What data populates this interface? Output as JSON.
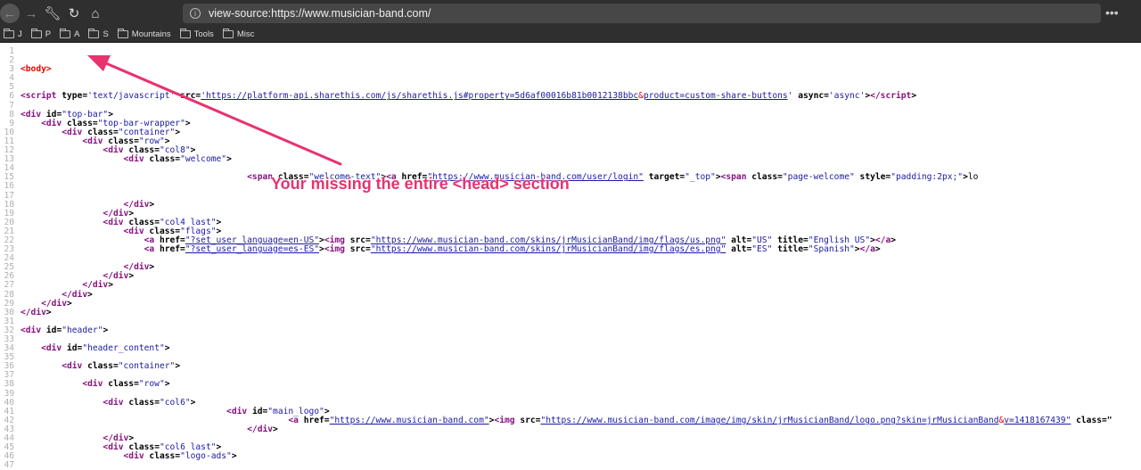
{
  "browser": {
    "url": "view-source:https://www.musician-band.com/",
    "nav_icons": [
      "back-icon",
      "forward-icon",
      "wrench-icon",
      "reload-icon",
      "home-icon"
    ],
    "bookmarks": [
      "J",
      "P",
      "A",
      "S",
      "Mountains",
      "Tools",
      "Misc"
    ],
    "more": "•••"
  },
  "annotation": {
    "text": "Your missing the entire <head> section",
    "color": "#e8336e"
  },
  "lines": [
    [],
    [],
    [
      [
        "body",
        "<body>"
      ]
    ],
    [],
    [],
    [
      [
        "tag",
        "<script "
      ],
      [
        "attr",
        "type="
      ],
      [
        "val",
        "'text/javascript'"
      ],
      [
        "attr",
        " src="
      ],
      [
        "link",
        "'https://platform-api.sharethis.com/js/sharethis.js#property=5d6af00016b81b0012138bbc"
      ],
      [
        "amp",
        "&"
      ],
      [
        "link",
        "product=custom-share-buttons"
      ],
      [
        "val",
        "'"
      ],
      [
        "attr",
        " async="
      ],
      [
        "val",
        "'async'"
      ],
      [
        "attr",
        ">"
      ],
      [
        "tag",
        "</script"
      ],
      [
        "attr",
        ">"
      ]
    ],
    [],
    [
      [
        "tag",
        "<div "
      ],
      [
        "attr",
        "id="
      ],
      [
        "val",
        "\"top-bar\""
      ],
      [
        "attr",
        ">"
      ]
    ],
    [
      [
        "txt",
        "    "
      ],
      [
        "tag",
        "<div "
      ],
      [
        "attr",
        "class="
      ],
      [
        "val",
        "\"top-bar-wrapper\""
      ],
      [
        "attr",
        ">"
      ]
    ],
    [
      [
        "txt",
        "        "
      ],
      [
        "tag",
        "<div "
      ],
      [
        "attr",
        "class="
      ],
      [
        "val",
        "\"container\""
      ],
      [
        "attr",
        ">"
      ]
    ],
    [
      [
        "txt",
        "            "
      ],
      [
        "tag",
        "<div "
      ],
      [
        "attr",
        "class="
      ],
      [
        "val",
        "\"row\""
      ],
      [
        "attr",
        ">"
      ]
    ],
    [
      [
        "txt",
        "                "
      ],
      [
        "tag",
        "<div "
      ],
      [
        "attr",
        "class="
      ],
      [
        "val",
        "\"col8\""
      ],
      [
        "attr",
        ">"
      ]
    ],
    [
      [
        "txt",
        "                    "
      ],
      [
        "tag",
        "<div "
      ],
      [
        "attr",
        "class="
      ],
      [
        "val",
        "\"welcome\""
      ],
      [
        "attr",
        ">"
      ]
    ],
    [],
    [
      [
        "txt",
        "                                            "
      ],
      [
        "tag",
        "<span "
      ],
      [
        "attr",
        "class="
      ],
      [
        "val",
        "\"welcome-text\""
      ],
      [
        "attr",
        ">"
      ],
      [
        "tag",
        "<a "
      ],
      [
        "attr",
        "href="
      ],
      [
        "link",
        "\"https://www.musician-band.com/user/login\""
      ],
      [
        "attr",
        " target="
      ],
      [
        "val",
        "\"_top\""
      ],
      [
        "attr",
        ">"
      ],
      [
        "tag",
        "<span "
      ],
      [
        "attr",
        "class="
      ],
      [
        "val",
        "\"page-welcome\""
      ],
      [
        "attr",
        " style="
      ],
      [
        "val",
        "\"padding:2px;\""
      ],
      [
        "attr",
        ">"
      ],
      [
        "txt",
        "lo"
      ]
    ],
    [],
    [],
    [
      [
        "txt",
        "                    "
      ],
      [
        "tag",
        "</div"
      ],
      [
        "attr",
        ">"
      ]
    ],
    [
      [
        "txt",
        "                "
      ],
      [
        "tag",
        "</div"
      ],
      [
        "attr",
        ">"
      ]
    ],
    [
      [
        "txt",
        "                "
      ],
      [
        "tag",
        "<div "
      ],
      [
        "attr",
        "class="
      ],
      [
        "val",
        "\"col4 last\""
      ],
      [
        "attr",
        ">"
      ]
    ],
    [
      [
        "txt",
        "                    "
      ],
      [
        "tag",
        "<div "
      ],
      [
        "attr",
        "class="
      ],
      [
        "val",
        "\"flags\""
      ],
      [
        "attr",
        ">"
      ]
    ],
    [
      [
        "txt",
        "                        "
      ],
      [
        "tag",
        "<a "
      ],
      [
        "attr",
        "href="
      ],
      [
        "link",
        "\"?set_user_language=en-US\""
      ],
      [
        "attr",
        ">"
      ],
      [
        "tag",
        "<img "
      ],
      [
        "attr",
        "src="
      ],
      [
        "link",
        "\"https://www.musician-band.com/skins/jrMusicianBand/img/flags/us.png\""
      ],
      [
        "attr",
        " alt="
      ],
      [
        "val",
        "\"US\""
      ],
      [
        "attr",
        " title="
      ],
      [
        "val",
        "\"English US\""
      ],
      [
        "attr",
        ">"
      ],
      [
        "tag",
        "</a"
      ],
      [
        "attr",
        ">"
      ]
    ],
    [
      [
        "txt",
        "                        "
      ],
      [
        "tag",
        "<a "
      ],
      [
        "attr",
        "href="
      ],
      [
        "link",
        "\"?set_user_language=es-ES\""
      ],
      [
        "attr",
        ">"
      ],
      [
        "tag",
        "<img "
      ],
      [
        "attr",
        "src="
      ],
      [
        "link",
        "\"https://www.musician-band.com/skins/jrMusicianBand/img/flags/es.png\""
      ],
      [
        "attr",
        " alt="
      ],
      [
        "val",
        "\"ES\""
      ],
      [
        "attr",
        " title="
      ],
      [
        "val",
        "\"Spanish\""
      ],
      [
        "attr",
        ">"
      ],
      [
        "tag",
        "</a"
      ],
      [
        "attr",
        ">"
      ]
    ],
    [],
    [
      [
        "txt",
        "                    "
      ],
      [
        "tag",
        "</div"
      ],
      [
        "attr",
        ">"
      ]
    ],
    [
      [
        "txt",
        "                "
      ],
      [
        "tag",
        "</div"
      ],
      [
        "attr",
        ">"
      ]
    ],
    [
      [
        "txt",
        "            "
      ],
      [
        "tag",
        "</div"
      ],
      [
        "attr",
        ">"
      ]
    ],
    [
      [
        "txt",
        "        "
      ],
      [
        "tag",
        "</div"
      ],
      [
        "attr",
        ">"
      ]
    ],
    [
      [
        "txt",
        "    "
      ],
      [
        "tag",
        "</div"
      ],
      [
        "attr",
        ">"
      ]
    ],
    [
      [
        "tag",
        "</div"
      ],
      [
        "attr",
        ">"
      ]
    ],
    [],
    [
      [
        "tag",
        "<div "
      ],
      [
        "attr",
        "id="
      ],
      [
        "val",
        "\"header\""
      ],
      [
        "attr",
        ">"
      ]
    ],
    [],
    [
      [
        "txt",
        "    "
      ],
      [
        "tag",
        "<div "
      ],
      [
        "attr",
        "id="
      ],
      [
        "val",
        "\"header_content\""
      ],
      [
        "attr",
        ">"
      ]
    ],
    [],
    [
      [
        "txt",
        "        "
      ],
      [
        "tag",
        "<div "
      ],
      [
        "attr",
        "class="
      ],
      [
        "val",
        "\"container\""
      ],
      [
        "attr",
        ">"
      ]
    ],
    [],
    [
      [
        "txt",
        "            "
      ],
      [
        "tag",
        "<div "
      ],
      [
        "attr",
        "class="
      ],
      [
        "val",
        "\"row\""
      ],
      [
        "attr",
        ">"
      ]
    ],
    [],
    [
      [
        "txt",
        "                "
      ],
      [
        "tag",
        "<div "
      ],
      [
        "attr",
        "class="
      ],
      [
        "val",
        "\"col6\""
      ],
      [
        "attr",
        ">"
      ]
    ],
    [
      [
        "txt",
        "                                        "
      ],
      [
        "tag",
        "<div "
      ],
      [
        "attr",
        "id="
      ],
      [
        "val",
        "\"main_logo\""
      ],
      [
        "attr",
        ">"
      ]
    ],
    [
      [
        "txt",
        "                                                    "
      ],
      [
        "tag",
        "<a "
      ],
      [
        "attr",
        "href="
      ],
      [
        "link",
        "\"https://www.musician-band.com\""
      ],
      [
        "attr",
        ">"
      ],
      [
        "tag",
        "<img "
      ],
      [
        "attr",
        "src="
      ],
      [
        "link",
        "\"https://www.musician-band.com/image/img/skin/jrMusicianBand/logo.png?skin=jrMusicianBand"
      ],
      [
        "amp",
        "&"
      ],
      [
        "link",
        "v=1418167439\""
      ],
      [
        "attr",
        " class=\""
      ]
    ],
    [
      [
        "txt",
        "                                            "
      ],
      [
        "tag",
        "</div"
      ],
      [
        "attr",
        ">"
      ]
    ],
    [
      [
        "txt",
        "                "
      ],
      [
        "tag",
        "</div"
      ],
      [
        "attr",
        ">"
      ]
    ],
    [
      [
        "txt",
        "                "
      ],
      [
        "tag",
        "<div "
      ],
      [
        "attr",
        "class="
      ],
      [
        "val",
        "\"col6 last\""
      ],
      [
        "attr",
        ">"
      ]
    ],
    [
      [
        "txt",
        "                    "
      ],
      [
        "tag",
        "<div "
      ],
      [
        "attr",
        "class="
      ],
      [
        "val",
        "\"logo-ads\""
      ],
      [
        "attr",
        ">"
      ]
    ],
    []
  ]
}
